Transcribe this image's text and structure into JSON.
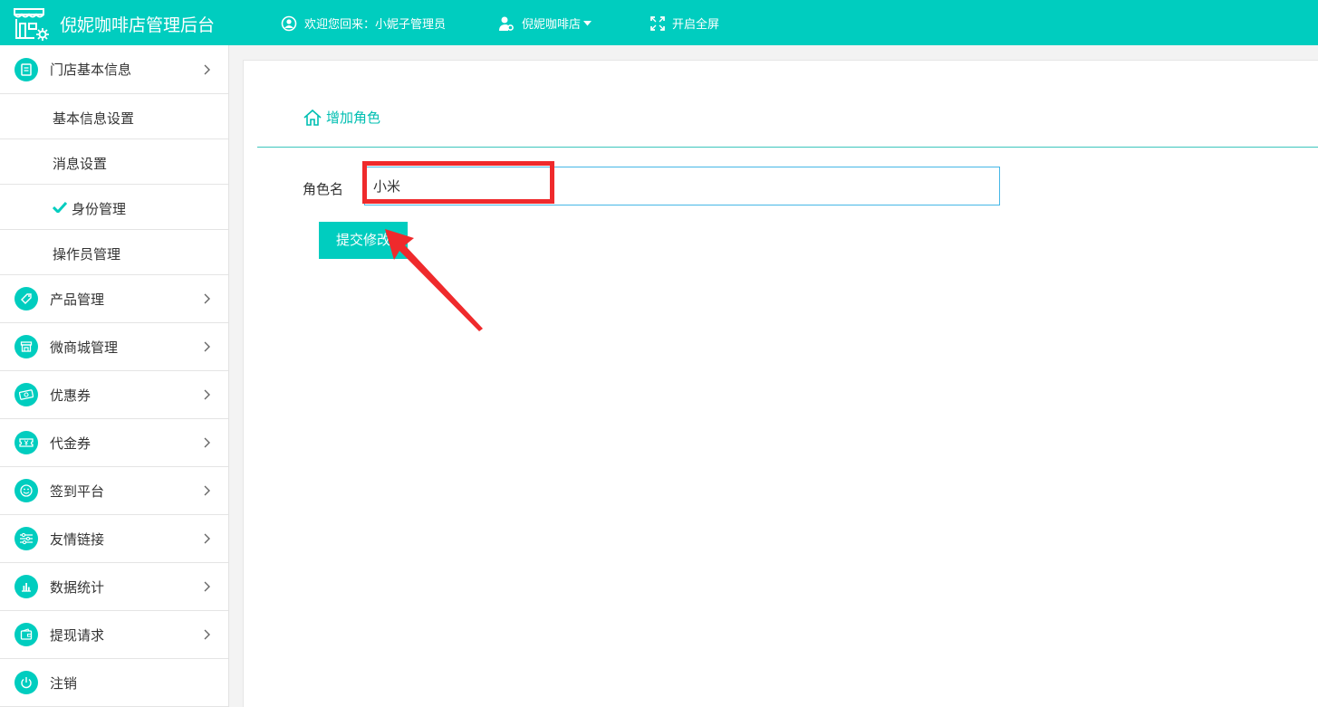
{
  "header": {
    "app_title": "倪妮咖啡店管理后台",
    "welcome_text": "欢迎您回来：小妮子管理员",
    "store_selector": "倪妮咖啡店",
    "fullscreen_label": "开启全屏",
    "bar_color": "#00cdbf"
  },
  "sidebar": {
    "store_info": {
      "label": "门店基本信息",
      "icon": "document-icon",
      "children": [
        {
          "label": "基本信息设置"
        },
        {
          "label": "消息设置"
        },
        {
          "label": "身份管理",
          "active": true
        },
        {
          "label": "操作员管理"
        }
      ]
    },
    "items": [
      {
        "label": "产品管理",
        "icon": "tag-icon"
      },
      {
        "label": "微商城管理",
        "icon": "store-icon"
      },
      {
        "label": "优惠券",
        "icon": "coupon-icon"
      },
      {
        "label": "代金券",
        "icon": "voucher-icon"
      },
      {
        "label": "签到平台",
        "icon": "smile-icon"
      },
      {
        "label": "友情链接",
        "icon": "sliders-icon"
      },
      {
        "label": "数据统计",
        "icon": "bar-chart-icon"
      },
      {
        "label": "提现请求",
        "icon": "wallet-icon"
      },
      {
        "label": "注销",
        "icon": "power-icon"
      }
    ]
  },
  "main": {
    "breadcrumb": "增加角色",
    "form": {
      "role_name_label": "角色名",
      "role_name_value": "小米",
      "submit_label": "提交修改"
    }
  },
  "annotation_color": "#ef2a2c"
}
